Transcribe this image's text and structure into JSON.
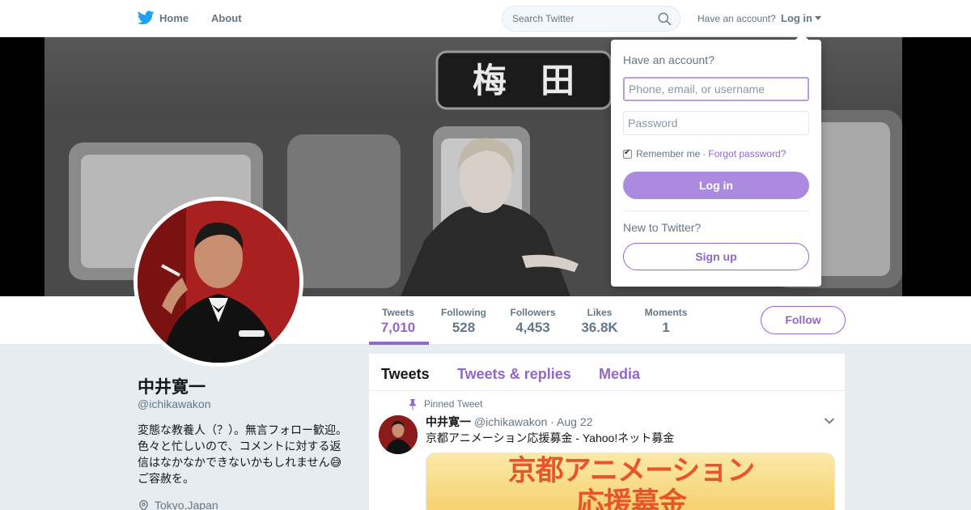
{
  "nav": {
    "home_label": "Home",
    "about_label": "About",
    "search_placeholder": "Search Twitter",
    "have_account": "Have an account?",
    "login_label": "Log in"
  },
  "profile": {
    "name": "中井寛一",
    "handle": "@ichikawakon",
    "bio": "変態な教養人（？）。無言フォロー歓迎。色々と忙しいので、コメントに対する返信はなかなかできないかもしれません😅 ご容赦を。",
    "location": "Tokyo,Japan"
  },
  "stats": [
    {
      "label": "Tweets",
      "value": "7,010"
    },
    {
      "label": "Following",
      "value": "528"
    },
    {
      "label": "Followers",
      "value": "4,453"
    },
    {
      "label": "Likes",
      "value": "36.8K"
    },
    {
      "label": "Moments",
      "value": "1"
    }
  ],
  "follow_label": "Follow",
  "timeline": {
    "tabs": [
      "Tweets",
      "Tweets & replies",
      "Media"
    ],
    "pinned_label": "Pinned Tweet",
    "tweet": {
      "name": "中井寛一",
      "handle": "@ichikawakon",
      "date": "· Aug 22",
      "text": "京都アニメーション応援募金 - Yahoo!ネット募金",
      "media_title": "京都アニメーション\n応援募金"
    }
  },
  "login_dropdown": {
    "title": "Have an account?",
    "username_placeholder": "Phone, email, or username",
    "password_placeholder": "Password",
    "remember_label": "Remember me",
    "separator": "·",
    "forgot_label": "Forgot password?",
    "login_button": "Log in",
    "new_label": "New to Twitter?",
    "signup_button": "Sign up"
  },
  "banner_sign_text": "梅　田",
  "colors": {
    "accent": "#9266cc",
    "brand_blue": "#1da1f2",
    "login_button_bg": "#ab8be0",
    "page_bg": "#e6ecf0"
  },
  "icons": {
    "logo": "twitter-bird-icon",
    "search": "search-icon",
    "location": "location-pin-icon",
    "pinned": "pin-icon",
    "tweet_menu": "chevron-down-icon"
  }
}
